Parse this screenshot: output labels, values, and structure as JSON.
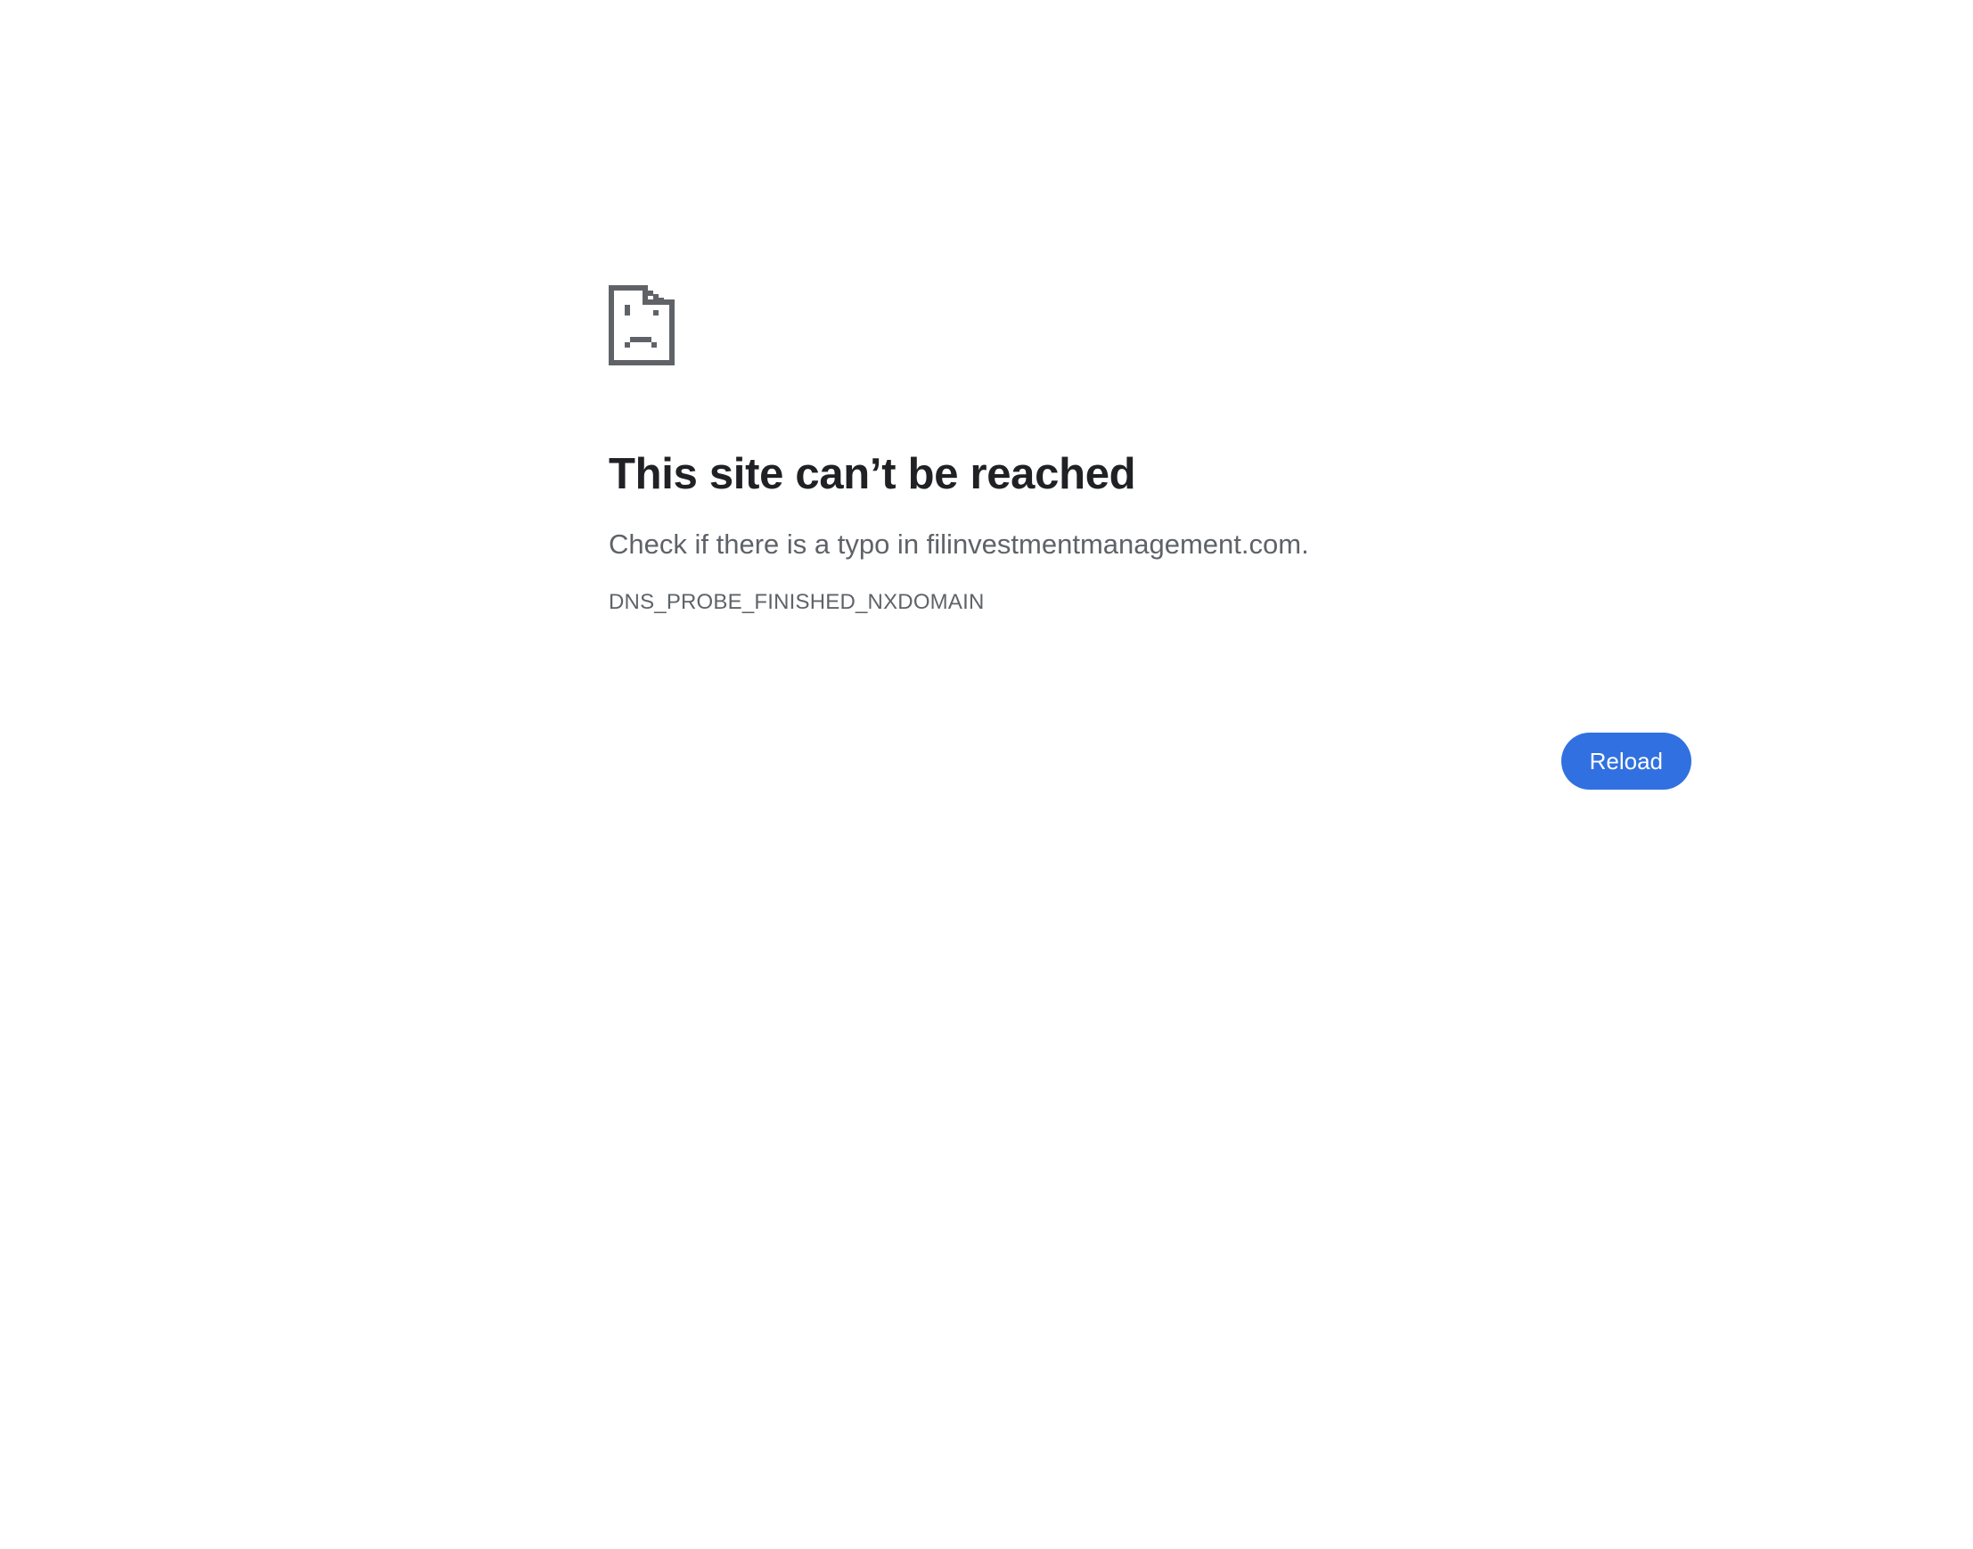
{
  "error_page": {
    "icon": "sad-document-icon",
    "title": "This site can’t be reached",
    "suggestion": "Check if there is a typo in filinvestmentmanagement.com.",
    "error_code": "DNS_PROBE_FINISHED_NXDOMAIN",
    "reload_label": "Reload"
  },
  "colors": {
    "background": "#ffffff",
    "title": "#202124",
    "secondary_text": "#5f6368",
    "icon": "#5f6368",
    "button": "#3170e0",
    "button_text": "#ffffff"
  }
}
